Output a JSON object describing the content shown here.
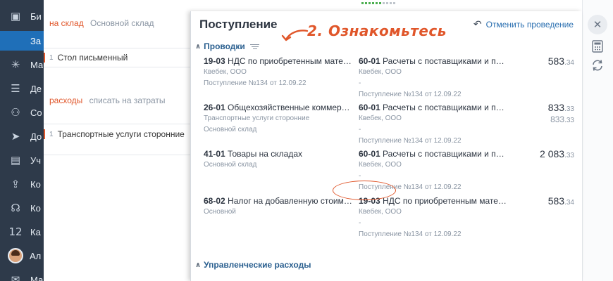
{
  "sidebar": {
    "items": [
      {
        "icon": "briefcase-icon",
        "glyph": "▣",
        "label": "Би"
      },
      {
        "icon": "",
        "glyph": "",
        "label": "За"
      },
      {
        "icon": "sparkle-icon",
        "glyph": "✳",
        "label": "Ма"
      },
      {
        "icon": "list-icon",
        "glyph": "☰",
        "label": "Де"
      },
      {
        "icon": "users-icon",
        "glyph": "⚇",
        "label": "Со"
      },
      {
        "icon": "send-icon",
        "glyph": "➤",
        "label": "До"
      },
      {
        "icon": "id-card-icon",
        "glyph": "▤",
        "label": "Уч"
      },
      {
        "icon": "upload-icon",
        "glyph": "⇪",
        "label": "Ко"
      },
      {
        "icon": "headset-icon",
        "glyph": "☊",
        "label": "Ко"
      },
      {
        "icon": "calendar-icon",
        "glyph": "12",
        "label": "Ка"
      },
      {
        "icon": "avatar",
        "glyph": "",
        "label": "Ал"
      },
      {
        "icon": "mail-icon",
        "glyph": "✉",
        "label": "Ма"
      }
    ],
    "submenu_label": "За"
  },
  "background": {
    "row1_title": "на склад",
    "row1_value": "Основной склад",
    "pos1_num": "1",
    "pos1_text": "Стол письменный",
    "row2_title": "расходы",
    "row2_value": "списать на затраты",
    "pos2_num": "1",
    "pos2_text": "Транспортные услуги сторонние"
  },
  "panel": {
    "title": "Поступление",
    "undo_label": "Отменить проведение",
    "annotation": "2. Ознакомьтесь",
    "section1": "Проводки",
    "section2": "Управленческие расходы",
    "entries": [
      {
        "debit_code": "19-03",
        "debit_name": "НДС по приобретенным матери...",
        "debit_sub1": "Квебек, ООО",
        "debit_sub2": "Поступление №134 от 12.09.22",
        "credit_code": "60-01",
        "credit_name": "Расчеты с поставщиками и по...",
        "credit_sub1": "Квебек, ООО",
        "credit_sub2": "-",
        "credit_sub3": "Поступление №134 от 12.09.22",
        "amount_int": "583",
        "amount_frac": ".34",
        "amount2_int": "",
        "amount2_frac": ""
      },
      {
        "debit_code": "26-01",
        "debit_name": "Общехозяйственные коммерче...",
        "debit_sub1": "Транспортные услуги сторонние",
        "debit_sub2": "Основной склад",
        "credit_code": "60-01",
        "credit_name": "Расчеты с поставщиками и по...",
        "credit_sub1": "Квебек, ООО",
        "credit_sub2": "-",
        "credit_sub3": "Поступление №134 от 12.09.22",
        "amount_int": "833",
        "amount_frac": ".33",
        "amount2_int": "833",
        "amount2_frac": ".33"
      },
      {
        "debit_code": "41-01",
        "debit_name": "Товары на складах",
        "debit_sub1": "Основной склад",
        "debit_sub2": "",
        "credit_code": "60-01",
        "credit_name": "Расчеты с поставщиками и по...",
        "credit_sub1": "Квебек, ООО",
        "credit_sub2": "-",
        "credit_sub3": "Поступление №134 от 12.09.22",
        "amount_int": "2 083",
        "amount_frac": ".33",
        "amount2_int": "",
        "amount2_frac": ""
      },
      {
        "debit_code": "68-02",
        "debit_name": "Налог на добавленную стоимость",
        "debit_sub1": "Основной",
        "debit_sub2": "",
        "credit_code": "19-03",
        "credit_name": "НДС по приобретенным матер...",
        "credit_sub1": "Квебек, ООО",
        "credit_sub2": "-",
        "credit_sub3": "Поступление №134 от 12.09.22",
        "amount_int": "583",
        "amount_frac": ".34",
        "amount2_int": "",
        "amount2_frac": ""
      }
    ]
  },
  "colors": {
    "sidebar_bg": "#2e3a4a",
    "accent_orange": "#e0562a",
    "link_blue": "#2a6fb0"
  },
  "right_toolbar": [
    "close-icon",
    "calculator-icon",
    "refresh-icon"
  ]
}
